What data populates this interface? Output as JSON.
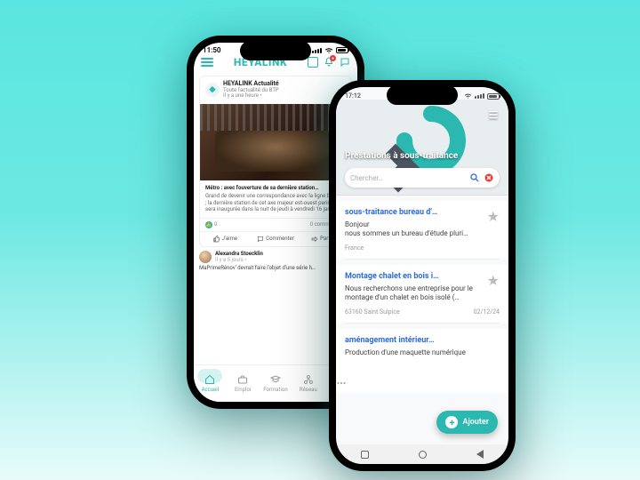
{
  "colors": {
    "accent": "#2bb8b0",
    "link": "#2b6cd7",
    "danger": "#e53935"
  },
  "p1": {
    "status": {
      "time": "11:50"
    },
    "brand": "HEYALINK",
    "notif_count": "●",
    "post": {
      "author": "HEYALINK Actualité",
      "subtitle": "Toute l'actualité du BTP",
      "time": "Il y a une heure •",
      "headline": "Métro : avec l'ouverture de sa dernière station…",
      "body": "Grand de devenir une correspondance avec la ligne bientôt ; la dernière station de cet axe majeur est-ouest parisien sera inaugurée dans la nuit de jeudi à vendredi 16 janvier.",
      "react_count": "0",
      "comments": "0 commentaire"
    },
    "actions": {
      "like": "J'aime",
      "comment": "Commenter",
      "share": "Partager"
    },
    "post2": {
      "author": "Alexandra Stoecklin",
      "time": "Il y a 5 jours •",
      "line": "MaPrimeRénov' devrait faire l'objet d'une série h…"
    },
    "tabs": [
      {
        "label": "Accueil"
      },
      {
        "label": "Emploi"
      },
      {
        "label": "Formation"
      },
      {
        "label": "Réseau"
      },
      {
        "label": ""
      }
    ]
  },
  "p2": {
    "status": {
      "time": "17:12"
    },
    "title": "Prestations à sous-traitance",
    "search_placeholder": "Chercher…",
    "items": [
      {
        "title": "sous-traitance bureau d'…",
        "body1": "Bonjour",
        "body2": "nous sommes un bureau d'étude pluri…",
        "footL": "France",
        "footR": ""
      },
      {
        "title": "Montage chalet en bois i…",
        "body1": "Nous recherchons une entreprise pour le montage d'un chalet en bois isolé (…",
        "body2": "",
        "footL": "63160 Saint Sulpice",
        "footR": "02/12/24"
      },
      {
        "title": "aménagement intérieur…",
        "body1": "Production d'une maquette numérique",
        "body2": "",
        "footL": "",
        "footR": ""
      }
    ],
    "fab": "Ajouter"
  }
}
